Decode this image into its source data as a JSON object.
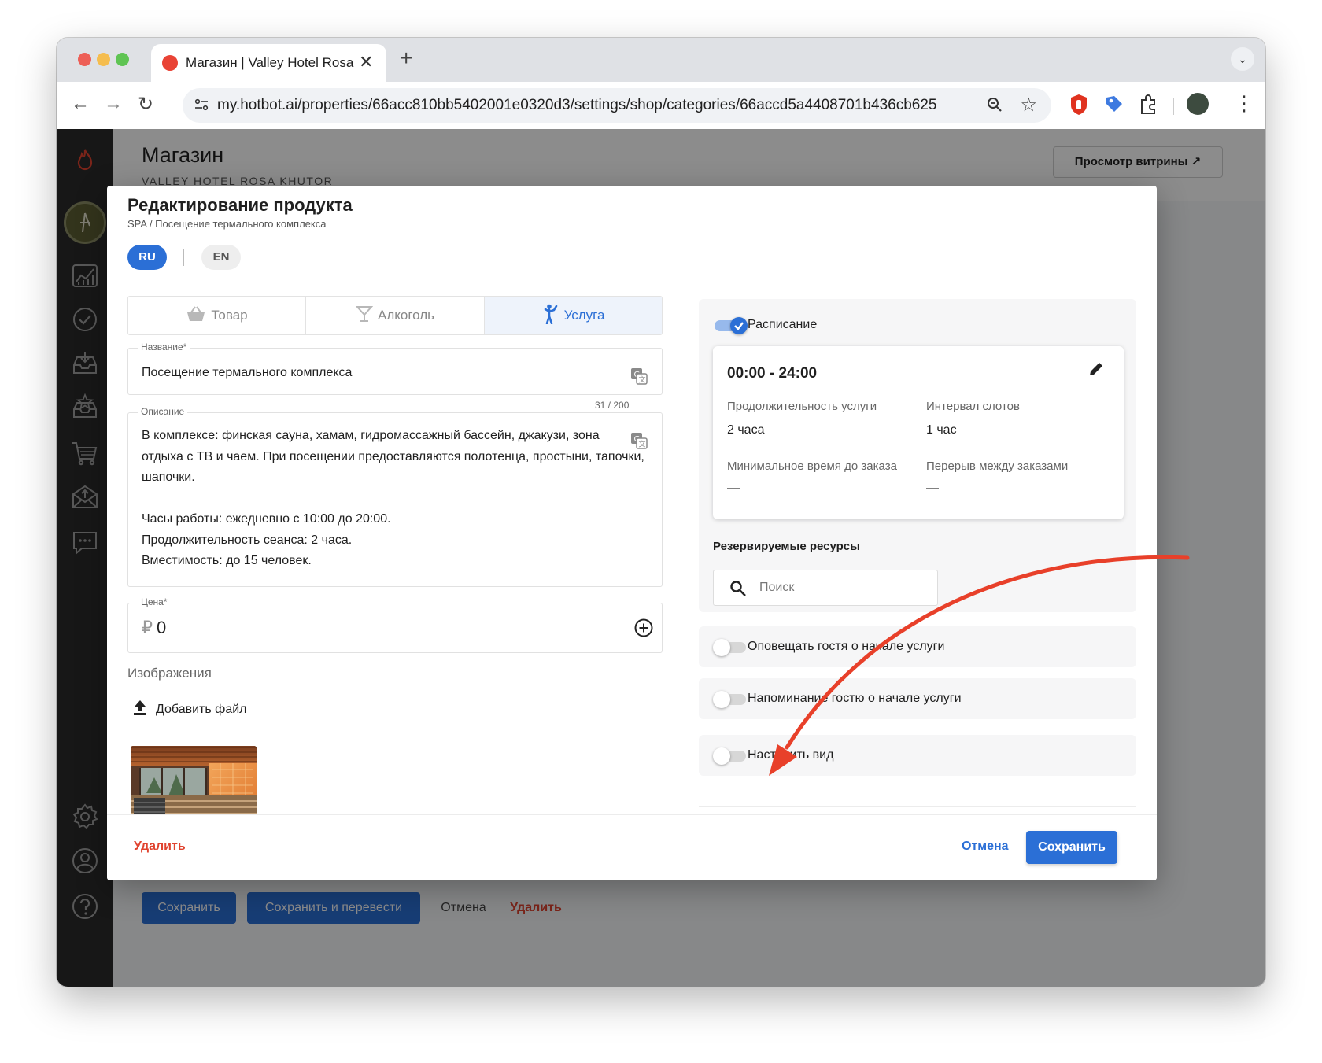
{
  "browser": {
    "tab_title": "Магазин | Valley Hotel Rosa K",
    "url": "my.hotbot.ai/properties/66acc810bb5402001e0320d3/settings/shop/categories/66accd5a4408701b436cb625",
    "new_tab": "+",
    "close": "✕"
  },
  "page": {
    "title": "Магазин",
    "subtitle": "VALLEY HOTEL ROSA KHUTOR",
    "showcase_button": "Просмотр витрины ↗"
  },
  "background_actions": {
    "save": "Сохранить",
    "save_translate": "Сохранить и перевести",
    "cancel": "Отмена",
    "delete": "Удалить"
  },
  "modal": {
    "title": "Редактирование продукта",
    "breadcrumb": "SPA / Посещение термального комплекса",
    "languages": [
      "RU",
      "EN"
    ],
    "active_language": "RU",
    "type_tabs": [
      {
        "label": "Товар",
        "icon": "basket-icon"
      },
      {
        "label": "Алкоголь",
        "icon": "cocktail-icon"
      },
      {
        "label": "Услуга",
        "icon": "person-service-icon"
      }
    ],
    "active_type": "Услуга",
    "name_field": {
      "label": "Название*",
      "value": "Посещение термального комплекса"
    },
    "description_field": {
      "label": "Описание",
      "counter": "31 / 200",
      "lines": [
        "В комплексе: финская сауна, хамам, гидромассажный бассейн, джакузи, зона",
        "отдыха с ТВ и чаем. При посещении предоставляются полотенца, простыни, тапочки,",
        "шапочки.",
        "",
        "Часы работы: ежедневно с 10:00 до 20:00.",
        "Продолжительность сеанса: 2 часа.",
        "Вместимость: до 15 человек."
      ]
    },
    "price_field": {
      "label": "Цена*",
      "currency": "₽",
      "value": "0"
    },
    "images": {
      "label": "Изображения",
      "add_file": "Добавить файл"
    },
    "schedule": {
      "toggle_label": "Расписание",
      "enabled": true,
      "time_range": "00:00 - 24:00",
      "duration_label": "Продолжительность услуги",
      "duration_value": "2 часа",
      "interval_label": "Интервал слотов",
      "interval_value": "1 час",
      "min_time_label": "Минимальное время до заказа",
      "min_time_value": "—",
      "break_label": "Перерыв между заказами",
      "break_value": "—"
    },
    "resources": {
      "label": "Резервируемые ресурсы",
      "search_placeholder": "Поиск"
    },
    "options": [
      {
        "label": "Оповещать гостя о начале услуги",
        "enabled": false
      },
      {
        "label": "Напоминание гостю о начале услуги",
        "enabled": false
      },
      {
        "label": "Настроить вид",
        "enabled": false
      }
    ],
    "footer": {
      "delete": "Удалить",
      "cancel": "Отмена",
      "save": "Сохранить"
    }
  },
  "colors": {
    "accent": "#2b6fd6",
    "danger": "#e0432f",
    "annotation_arrow": "#e8402a",
    "sidebar": "#2b2b2b"
  }
}
